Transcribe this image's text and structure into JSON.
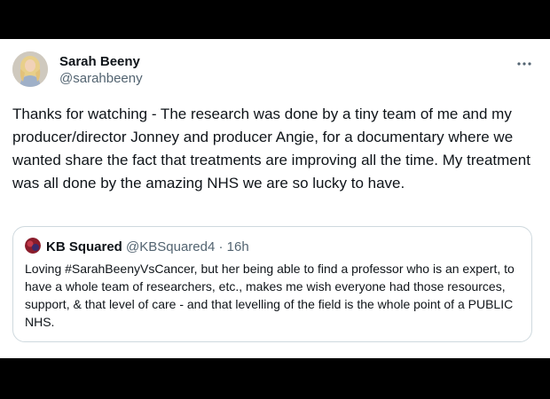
{
  "tweet": {
    "author": {
      "display_name": "Sarah Beeny",
      "handle": "@sarahbeeny",
      "avatar_icon": "profile-photo"
    },
    "more_icon": "more-horizontal-icon",
    "text": "Thanks for watching - The research was done by a tiny team of me and my producer/director Jonney and producer Angie, for a documentary where we wanted share the fact that treatments are improving all the time. My treatment was all done by the amazing NHS we are so lucky to have."
  },
  "quote": {
    "display_name": "KB Squared",
    "handle": "@KBSquared4",
    "separator": "·",
    "time": "16h",
    "text": "Loving #SarahBeenyVsCancer, but her being able to find a professor who is an expert, to have a whole team of researchers, etc., makes me wish everyone had those resources, support, & that level of care - and that levelling of the field is the whole point of a PUBLIC NHS."
  },
  "colors": {
    "primary_text": "#0f1419",
    "secondary_text": "#536471",
    "border": "#cfd9de",
    "background": "#ffffff",
    "letterbox": "#000000"
  }
}
